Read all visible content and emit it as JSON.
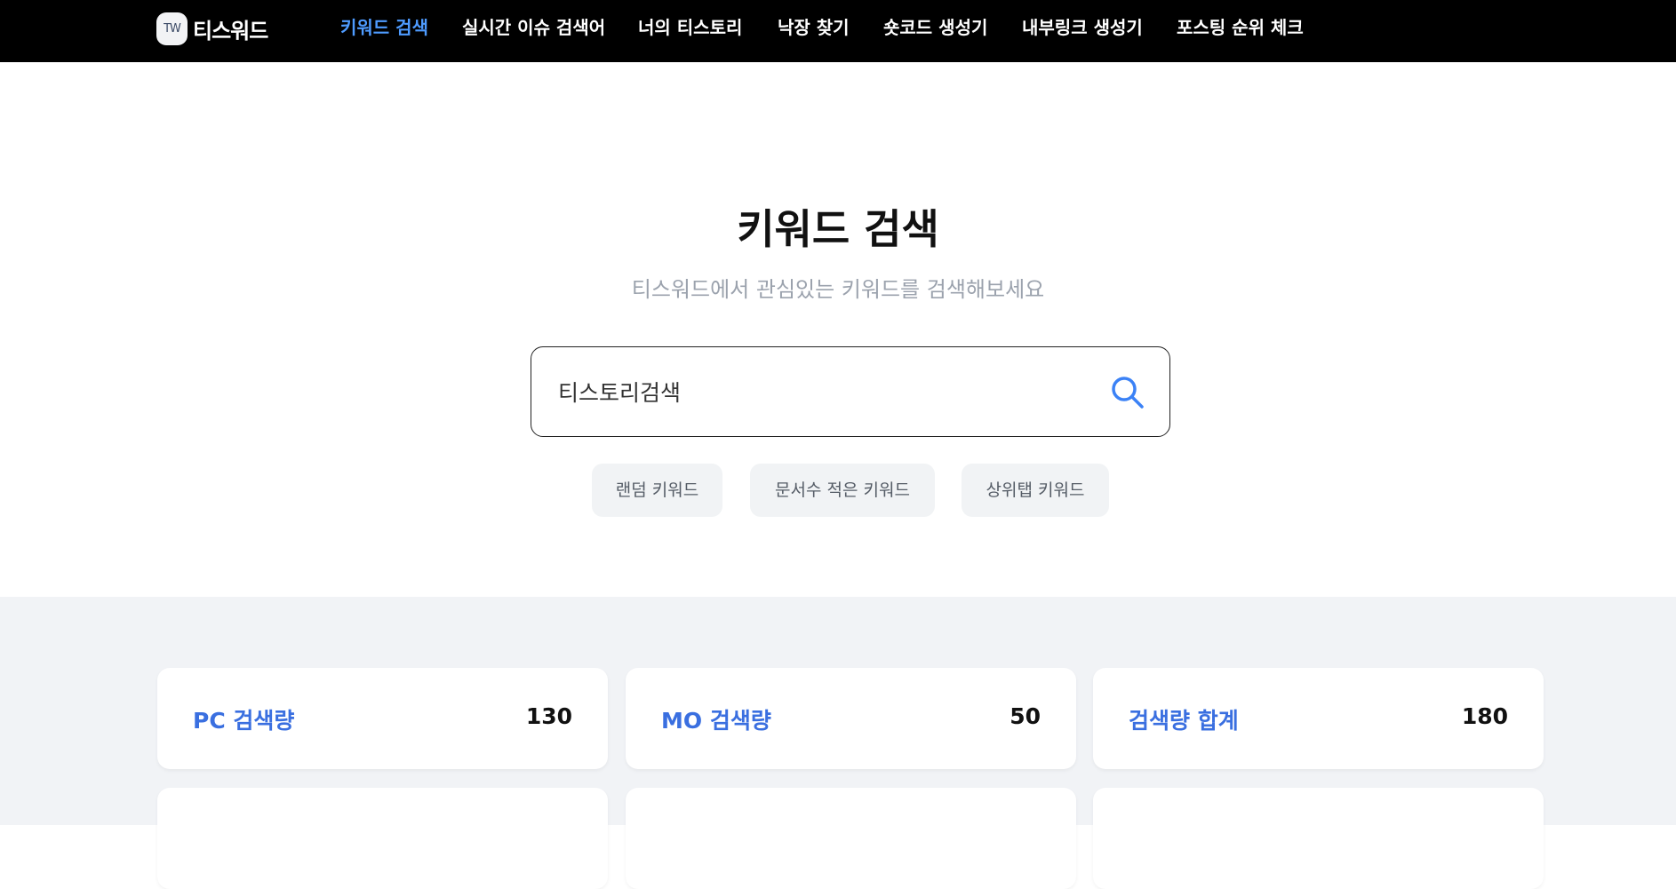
{
  "header": {
    "logo": {
      "badge": "TW",
      "text": "티스워드"
    },
    "nav": [
      {
        "label": "키워드 검색",
        "active": true
      },
      {
        "label": "실시간 이슈 검색어"
      },
      {
        "label": "너의 티스토리"
      },
      {
        "label": "낙장 찾기"
      },
      {
        "label": "숏코드 생성기"
      },
      {
        "label": "내부링크 생성기"
      },
      {
        "label": "포스팅 순위 체크"
      }
    ]
  },
  "hero": {
    "title": "키워드 검색",
    "subtitle": "티스워드에서 관심있는 키워드를 검색해보세요"
  },
  "search": {
    "value": "티스토리검색",
    "icon": "search-icon"
  },
  "chips": [
    {
      "label": "랜덤 키워드"
    },
    {
      "label": "문서수 적은 키워드"
    },
    {
      "label": "상위탭 키워드"
    }
  ],
  "stats": [
    {
      "label": "PC 검색량",
      "value": "130"
    },
    {
      "label": "MO 검색량",
      "value": "50"
    },
    {
      "label": "검색량 합계",
      "value": "180"
    }
  ],
  "colors": {
    "accent": "#4e9bff",
    "label_blue": "#3a6fe0",
    "topbar": "#000000",
    "stats_bg": "#f1f3f6"
  }
}
